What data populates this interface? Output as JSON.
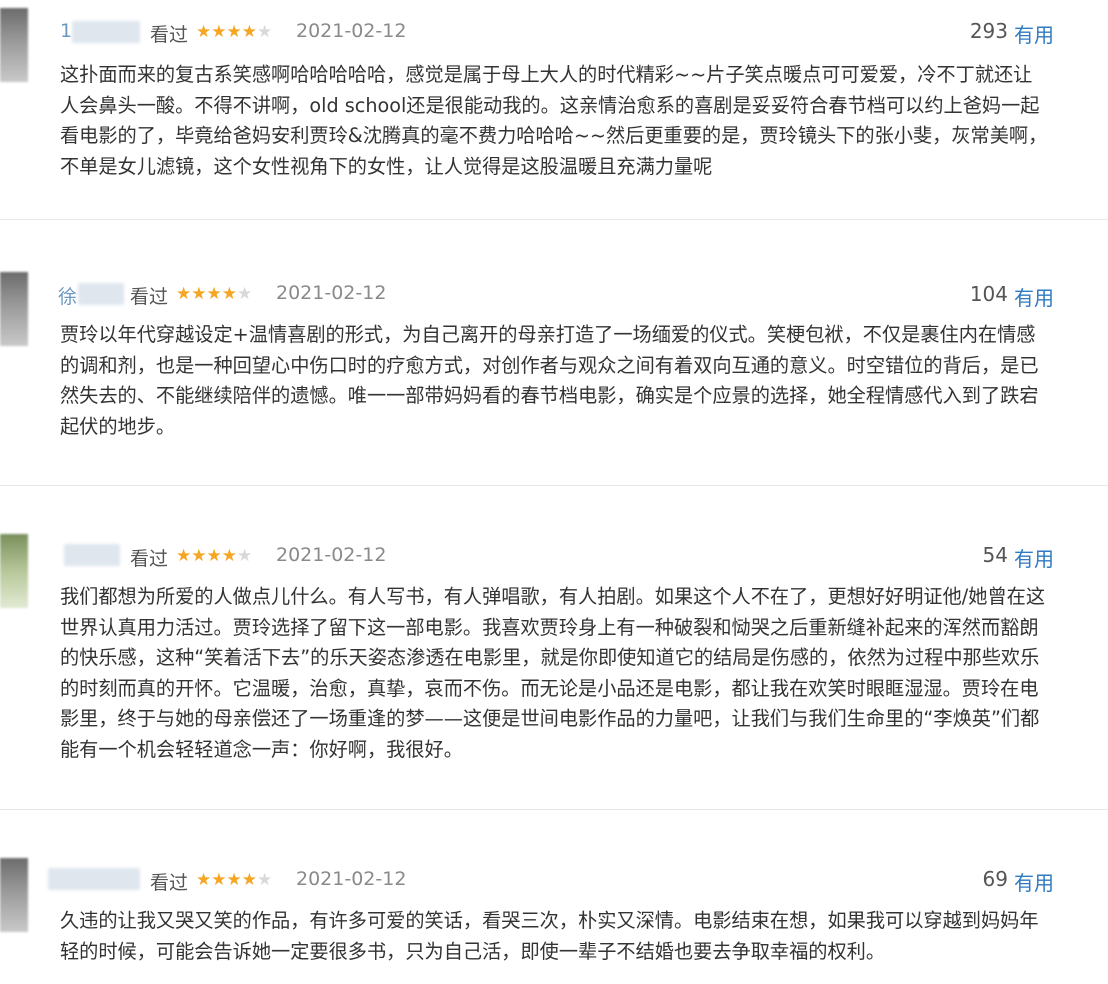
{
  "reviews": [
    {
      "user": "1",
      "watched": "看过",
      "rating": 4,
      "date": "2021-02-12",
      "votes": "293",
      "useful_label": "有用",
      "text": "这扑面而来的复古系笑感啊哈哈哈哈哈，感觉是属于母上大人的时代精彩~~片子笑点暖点可可爱爱，冷不丁就还让人会鼻头一酸。不得不讲啊，old school还是很能动我的。这亲情治愈系的喜剧是妥妥符合春节档可以约上爸妈一起看电影的了，毕竟给爸妈安利贾玲&沈腾真的毫不费力哈哈哈~~然后更重要的是，贾玲镜头下的张小斐，灰常美啊，不单是女儿滤镜，这个女性视角下的女性，让人觉得是这股温暖且充满力量呢"
    },
    {
      "user": "徐",
      "watched": "看过",
      "rating": 4,
      "date": "2021-02-12",
      "votes": "104",
      "useful_label": "有用",
      "text": "贾玲以年代穿越设定+温情喜剧的形式，为自己离开的母亲打造了一场缅爱的仪式。笑梗包袱，不仅是裹住内在情感的调和剂，也是一种回望心中伤口时的疗愈方式，对创作者与观众之间有着双向互通的意义。时空错位的背后，是已然失去的、不能继续陪伴的遗憾。唯一一部带妈妈看的春节档电影，确实是个应景的选择，她全程情感代入到了跌宕起伏的地步。"
    },
    {
      "user": "",
      "watched": "看过",
      "rating": 4,
      "date": "2021-02-12",
      "votes": "54",
      "useful_label": "有用",
      "text": "我们都想为所爱的人做点儿什么。有人写书，有人弹唱歌，有人拍剧。如果这个人不在了，更想好好明证他/她曾在这世界认真用力活过。贾玲选择了留下这一部电影。我喜欢贾玲身上有一种破裂和恸哭之后重新缝补起来的浑然而豁朗的快乐感，这种“笑着活下去”的乐天姿态渗透在电影里，就是你即使知道它的结局是伤感的，依然为过程中那些欢乐的时刻而真的开怀。它温暖，治愈，真挚，哀而不伤。而无论是小品还是电影，都让我在欢笑时眼眶湿湿。贾玲在电影里，终于与她的母亲偿还了一场重逢的梦——这便是世间电影作品的力量吧，让我们与我们生命里的“李焕英”们都能有一个机会轻轻道念一声：你好啊，我很好。"
    },
    {
      "user": "",
      "watched": "看过",
      "rating": 4,
      "date": "2021-02-12",
      "votes": "69",
      "useful_label": "有用",
      "text": "久违的让我又哭又笑的作品，有许多可爱的笑话，看哭三次，朴实又深情。电影结束在想，如果我可以穿越到妈妈年轻的时候，可能会告诉她一定要很多书，只为自己活，即使一辈子不结婚也要去争取幸福的权利。"
    }
  ],
  "colors": {
    "star_on": "#f5a623",
    "star_off": "#d9d9d9",
    "useful": "#2f7ac2"
  }
}
